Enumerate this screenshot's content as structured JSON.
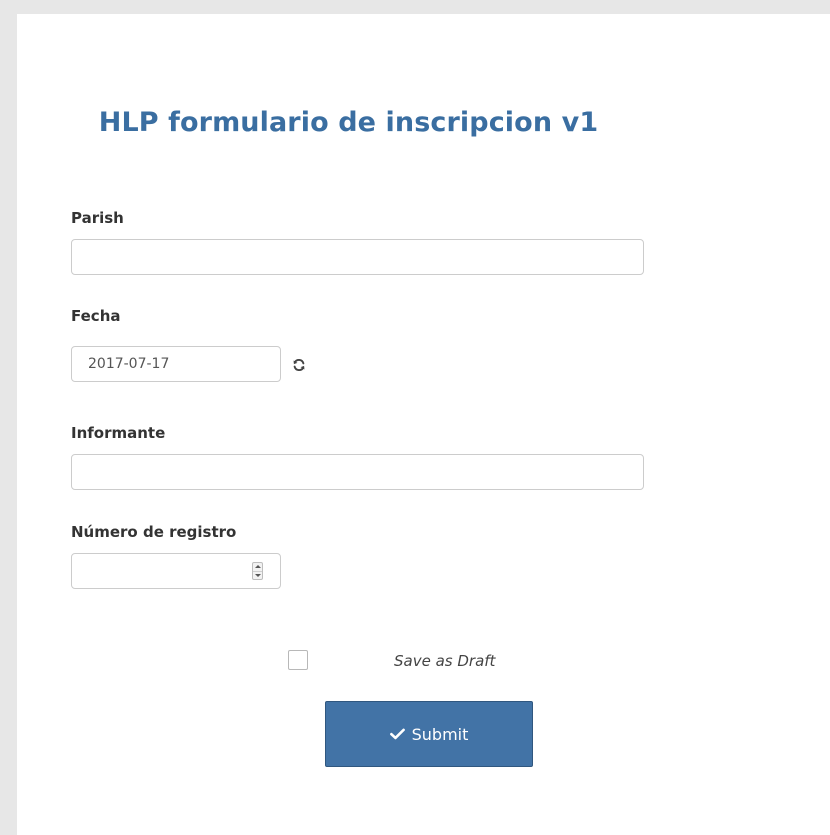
{
  "form": {
    "title": "HLP formulario de inscripcion v1",
    "fields": {
      "parish": {
        "label": "Parish",
        "value": ""
      },
      "fecha": {
        "label": "Fecha",
        "value": "2017-07-17"
      },
      "informante": {
        "label": "Informante",
        "value": ""
      },
      "numero_registro": {
        "label": "Número de registro",
        "value": ""
      }
    },
    "save_as_draft": {
      "label": "Save as Draft",
      "checked": false
    },
    "submit": {
      "label": "Submit",
      "icon": "check-icon"
    },
    "colors": {
      "title": "#3a6ea1",
      "submit_bg": "#4273a6"
    }
  }
}
